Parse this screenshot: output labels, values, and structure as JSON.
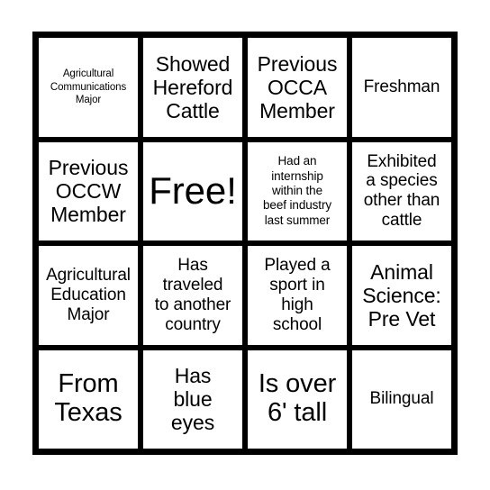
{
  "card": {
    "type": "bingo-card",
    "grid_rows": 4,
    "grid_columns": 4,
    "border_color": "#000000",
    "cell_background": "#ffffff",
    "page_background": "#ffffff",
    "text_color": "#000000",
    "cells": [
      {
        "id": "r1c1",
        "text": "Agricultural\nCommunications\nMajor",
        "size": "xs",
        "free_space": false
      },
      {
        "id": "r1c2",
        "text": "Showed\nHereford\nCattle",
        "size": "lg",
        "free_space": false
      },
      {
        "id": "r1c3",
        "text": "Previous\nOCCA\nMember",
        "size": "lg",
        "free_space": false
      },
      {
        "id": "r1c4",
        "text": "Freshman",
        "size": "md",
        "free_space": false
      },
      {
        "id": "r2c1",
        "text": "Previous\nOCCW\nMember",
        "size": "lg",
        "free_space": false
      },
      {
        "id": "r2c2",
        "text": "Free!",
        "size": "free",
        "free_space": true
      },
      {
        "id": "r2c3",
        "text": "Had an\ninternship\nwithin the\nbeef industry\nlast summer",
        "size": "sm",
        "free_space": false
      },
      {
        "id": "r2c4",
        "text": "Exhibited\na species\nother than\ncattle",
        "size": "md",
        "free_space": false
      },
      {
        "id": "r3c1",
        "text": "Agricultural\nEducation\nMajor",
        "size": "md",
        "free_space": false
      },
      {
        "id": "r3c2",
        "text": "Has\ntraveled\nto another\ncountry",
        "size": "md",
        "free_space": false
      },
      {
        "id": "r3c3",
        "text": "Played a\nsport in\nhigh\nschool",
        "size": "md",
        "free_space": false
      },
      {
        "id": "r3c4",
        "text": "Animal\nScience:\nPre Vet",
        "size": "lg",
        "free_space": false
      },
      {
        "id": "r4c1",
        "text": "From\nTexas",
        "size": "xl",
        "free_space": false
      },
      {
        "id": "r4c2",
        "text": "Has\nblue\neyes",
        "size": "lg",
        "free_space": false
      },
      {
        "id": "r4c3",
        "text": "Is over\n6' tall",
        "size": "xl",
        "free_space": false
      },
      {
        "id": "r4c4",
        "text": "Bilingual",
        "size": "md",
        "free_space": false
      }
    ]
  }
}
